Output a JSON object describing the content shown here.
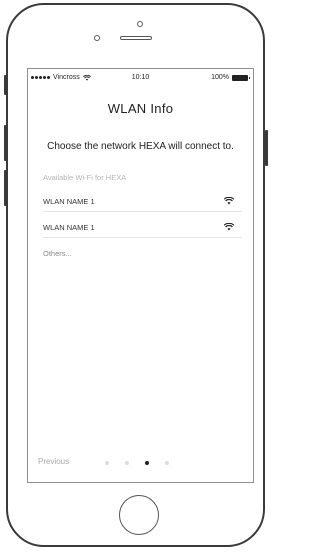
{
  "status_bar": {
    "carrier": "Vincross",
    "time": "10:10",
    "battery": "100%"
  },
  "header": {
    "title": "WLAN Info"
  },
  "instruction": "Choose the network HEXA will connect to.",
  "section_label": "Available Wi-Fi for HEXA",
  "networks": [
    {
      "name": "WLAN NAME 1",
      "icon": "wifi-icon"
    },
    {
      "name": "WLAN NAME 1",
      "icon": "wifi-icon"
    }
  ],
  "others_label": "Others...",
  "footer": {
    "previous_label": "Previous",
    "page_count": 4,
    "current_page": 3
  },
  "colors": {
    "text": "#222222",
    "muted": "#b5b5b5",
    "divider": "#e4e4e4"
  }
}
